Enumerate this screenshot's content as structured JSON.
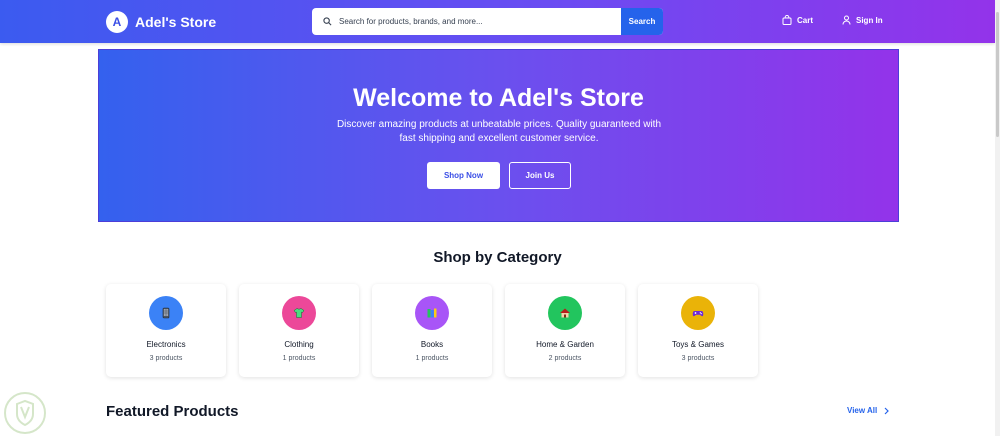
{
  "header": {
    "logo_letter": "A",
    "brand": "Adel's Store",
    "search": {
      "placeholder": "Search for products, brands, and more...",
      "button": "Search"
    },
    "cart_label": "Cart",
    "signin_label": "Sign In"
  },
  "hero": {
    "title": "Welcome to Adel's Store",
    "subtitle": "Discover amazing products at unbeatable prices. Quality guaranteed with fast shipping and excellent customer service.",
    "shop_button": "Shop Now",
    "join_button": "Join Us"
  },
  "categories": {
    "title": "Shop by Category",
    "items": [
      {
        "name": "Electronics",
        "count": "3 products",
        "icon": "phone-icon",
        "color": "#3b82f6"
      },
      {
        "name": "Clothing",
        "count": "1 products",
        "icon": "tshirt-icon",
        "color": "#ec4899"
      },
      {
        "name": "Books",
        "count": "1 products",
        "icon": "books-icon",
        "color": "#a855f7"
      },
      {
        "name": "Home & Garden",
        "count": "2 products",
        "icon": "house-icon",
        "color": "#22c55e"
      },
      {
        "name": "Toys & Games",
        "count": "3 products",
        "icon": "gamepad-icon",
        "color": "#eab308"
      }
    ]
  },
  "featured": {
    "title": "Featured Products",
    "view_all": "View All"
  }
}
